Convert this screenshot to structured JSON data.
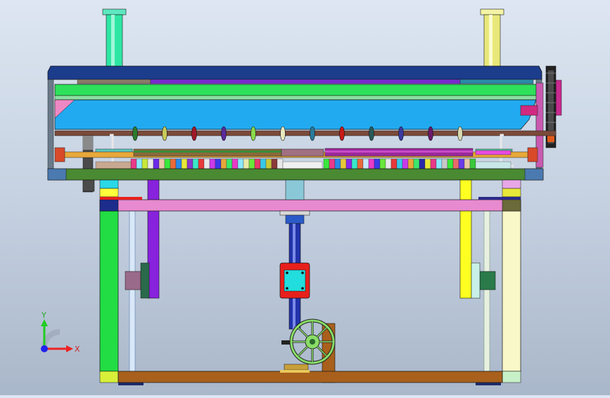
{
  "viewport": {
    "background_top": "#dde6f2",
    "background_bottom": "#a9b7ca"
  },
  "axis_triad": {
    "y_label": "Y",
    "x_label": "X",
    "y_color": "#22cc22",
    "x_color": "#ee2222",
    "z_color": "#2222ee"
  },
  "model_colors": {
    "top_plate": "#1c3c8c",
    "green_bar": "#2ee05a",
    "blue_panel": "#22aaf0",
    "base_strip": "#4a8a32",
    "pink_beam": "#e88ad0",
    "frame_green": "#22dd44",
    "frame_yellow": "#ffff22",
    "frame_purple": "#8822dd",
    "base_brown": "#a8601c",
    "column_blue": "#2233aa",
    "red_block": "#e8201c",
    "cyan_plate": "#22dddd",
    "handwheel": "#88dd66"
  }
}
